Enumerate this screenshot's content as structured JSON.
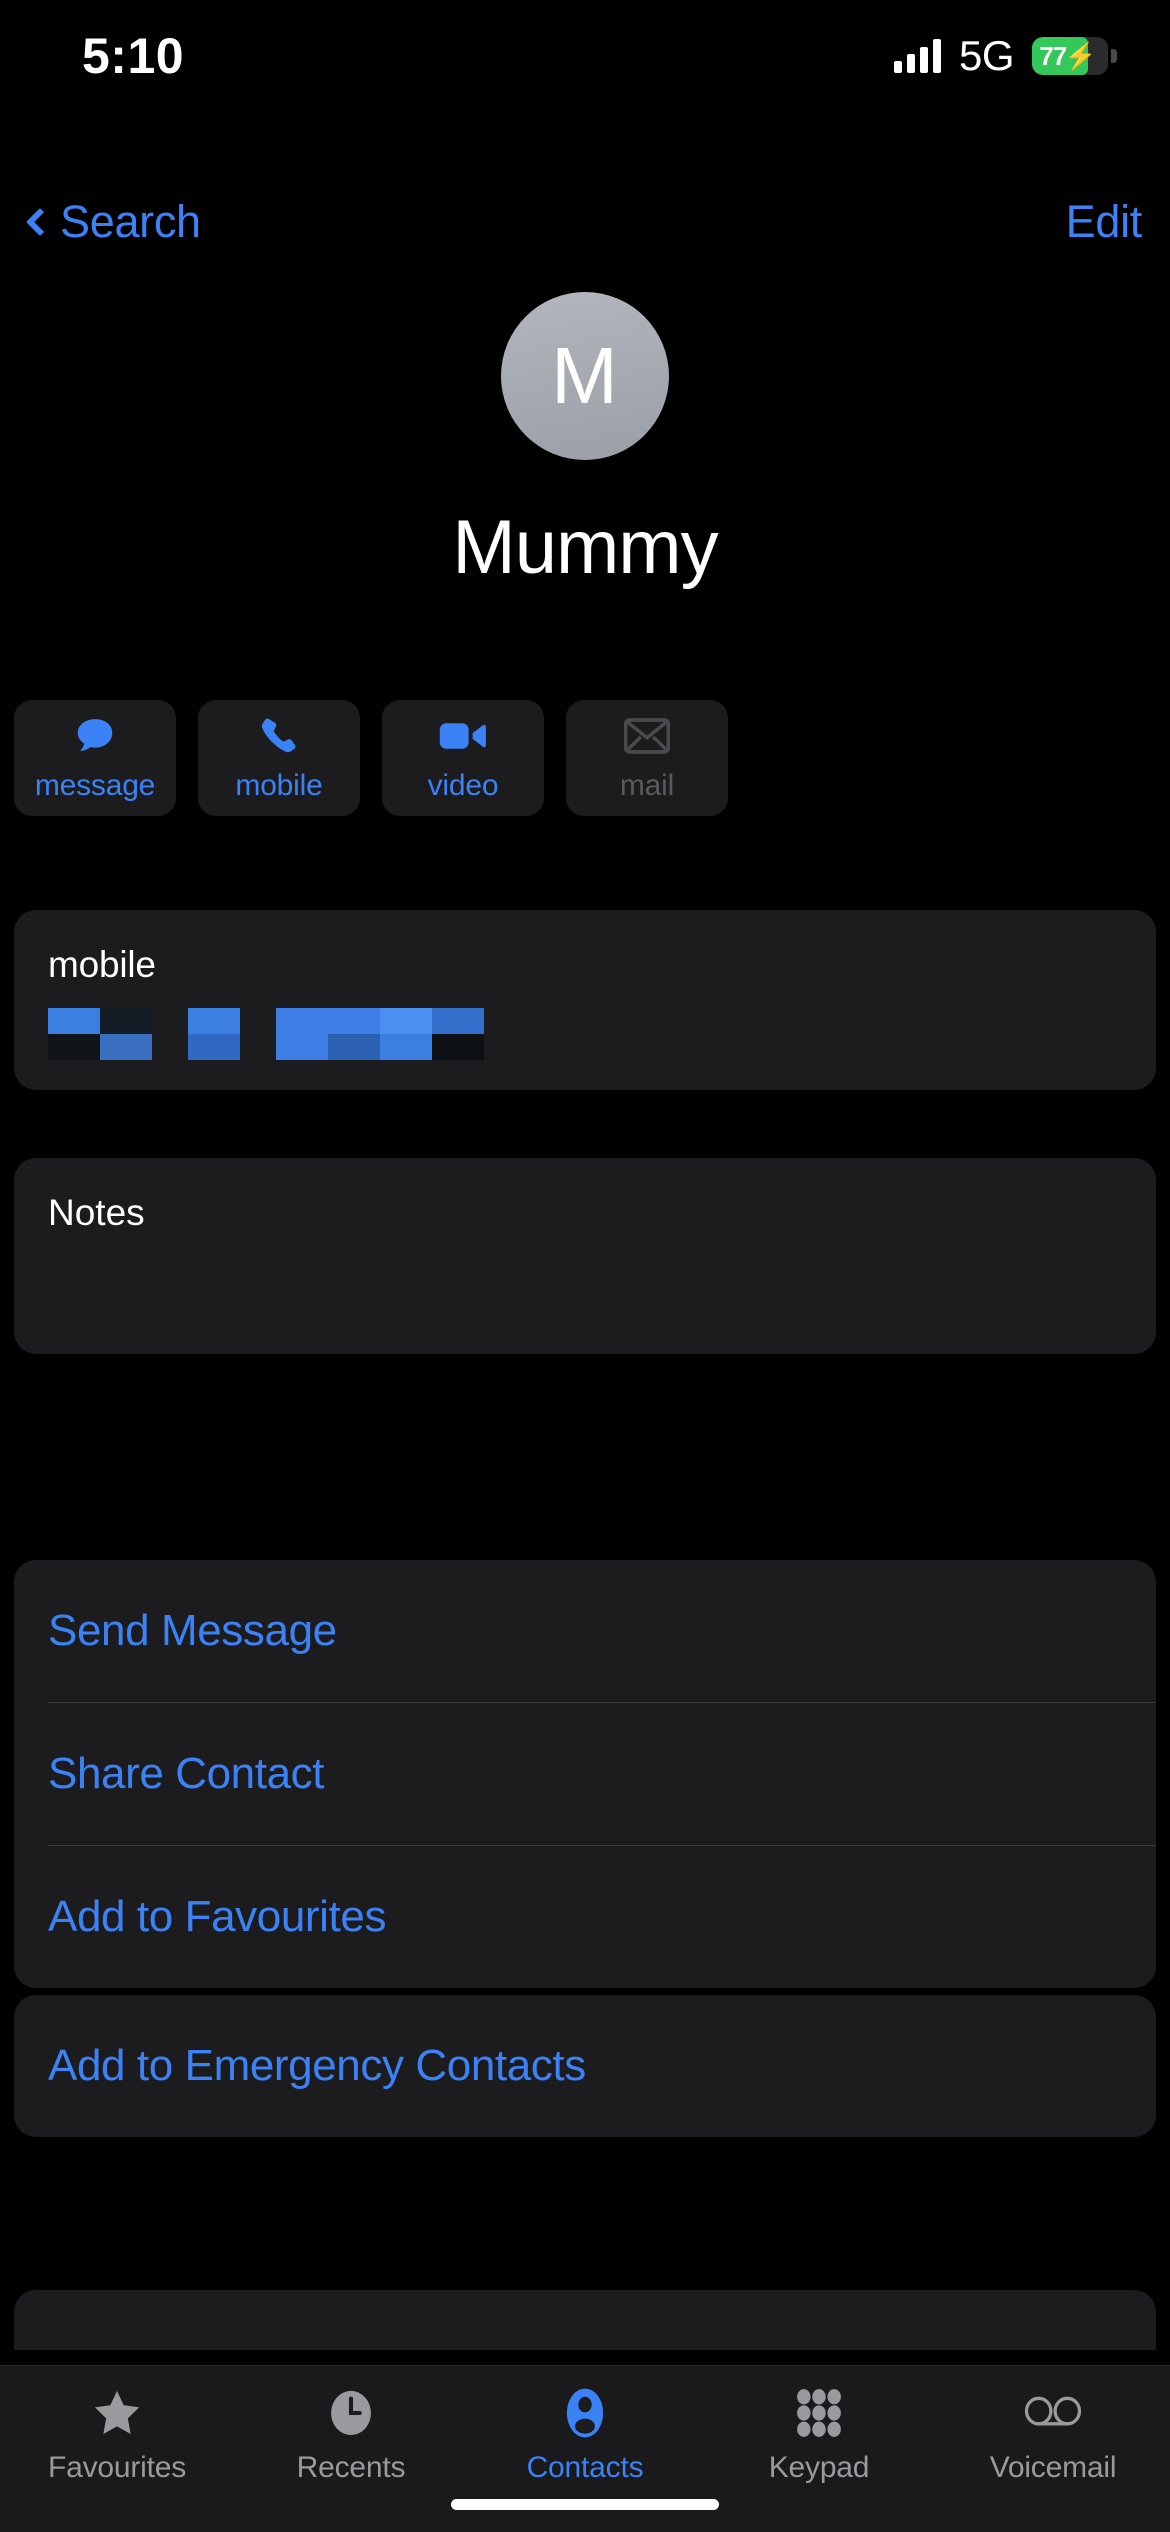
{
  "status_bar": {
    "time": "5:10",
    "network": "5G",
    "battery_percent": "77",
    "battery_charging": true,
    "battery_color": "#34C759",
    "signal_icon": "cellular-signal-icon",
    "battery_icon": "battery-icon",
    "bolt_glyph": "⚡"
  },
  "nav": {
    "back_label": "Search",
    "back_icon": "chevron-left-icon",
    "edit_label": "Edit"
  },
  "contact": {
    "initial": "M",
    "name": "Mummy",
    "avatar_icon": "contact-avatar"
  },
  "quick_actions": [
    {
      "label": "message",
      "icon": "message-bubble-icon",
      "enabled": true
    },
    {
      "label": "mobile",
      "icon": "phone-icon",
      "enabled": true
    },
    {
      "label": "video",
      "icon": "video-camera-icon",
      "enabled": true
    },
    {
      "label": "mail",
      "icon": "envelope-icon",
      "enabled": false
    }
  ],
  "phone_field": {
    "label": "mobile",
    "value_redacted": true,
    "redaction_color": "#3B7FE0"
  },
  "notes": {
    "label": "Notes",
    "value": ""
  },
  "action_links": [
    {
      "label": "Send Message"
    },
    {
      "label": "Share Contact"
    },
    {
      "label": "Add to Favourites"
    }
  ],
  "emergency_links": [
    {
      "label": "Add to Emergency Contacts"
    }
  ],
  "tab_bar": {
    "items": [
      {
        "label": "Favourites",
        "icon": "star-icon",
        "active": false
      },
      {
        "label": "Recents",
        "icon": "clock-icon",
        "active": false
      },
      {
        "label": "Contacts",
        "icon": "person-icon",
        "active": true
      },
      {
        "label": "Keypad",
        "icon": "keypad-icon",
        "active": false
      },
      {
        "label": "Voicemail",
        "icon": "voicemail-icon",
        "active": false
      }
    ]
  },
  "colors": {
    "accent": "#3B82F6",
    "card": "#1C1C1E",
    "background": "#000000",
    "disabled": "#5A5A5E"
  }
}
